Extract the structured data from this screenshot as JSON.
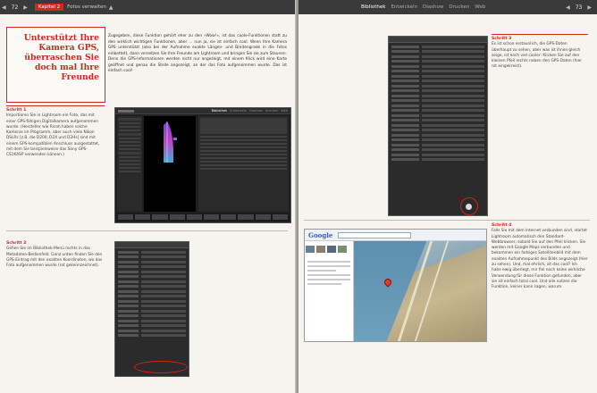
{
  "running_head_left": {
    "page_number": "72",
    "chapter": "Kapitel 2",
    "section": "Fotos verwalten"
  },
  "running_head_right": {
    "page_number": "73",
    "modules": [
      "Bibliothek",
      "Entwickeln",
      "Diashow",
      "Drucken",
      "Web"
    ],
    "active_module": "Bibliothek"
  },
  "headline": "Unterstützt Ihre Kamera GPS, überraschen Sie doch mal Ihre Freunde",
  "intro": "Zugegeben, diese Funktion gehört eher zu den »Wow!«, ist das coole-Funktionen statt zu den wirklich wichtigen Funktionen, aber ... nun ja, sie ist einfach cool. Wenn Ihre Kamera GPS unterstützt (also bei der Aufnahme exakte Längen- und Breitengrade in die Fotos einbettet), dann versetzen Sie Ihre Freunde am Lightroom und bringen Sie sie zum Staunen. Denn die GPS-Informationen werden nicht nur angezeigt, mit einem Klick wird eine Karte geöffnet und genau die Stelle angezeigt, an der das Foto aufgenommen wurde. Das ist einfach cool!",
  "steps": [
    {
      "title": "Schritt 1",
      "text": "Importieren Sie in Lightroom ein Foto, das mit einer GPS-fähigen Digitalkamera aufgenommen wurde. (Hersteller wie Ricoh haben solche Kameras im Programm, aber auch viele Nikon DSLRs [z.B. die D200, D2X und D2Hs] sind mit einem GPS-kompatiblen Anschluss ausgestattet, mit dem Sie beispielsweise das Sony GPS-CS1KASP verwenden können.)"
    },
    {
      "title": "Schritt 2",
      "text": "Gehen Sie im Bibliothek-Menü rechts in das Metadaten-Bedienfeld. Ganz unten finden Sie den GPS-Eintrag mit den exakten Koordinaten, wo das Foto aufgenommen wurde (rot gekennzeichnet)."
    },
    {
      "title": "Schritt 3",
      "text": "Es ist schon erstaunlich, die GPS-Daten überhaupt zu sehen, aber was ist ihnen gleich zeige, ist noch viel cooler: Klicken Sie auf den kleinen Pfeil rechts neben den GPS-Daten (hier rot eingekreist)."
    },
    {
      "title": "Schritt 4",
      "text": "Falls Sie mit dem Internet verbunden sind, startet Lightroom automatisch den Standard-Webbrowser, sobald Sie auf den Pfeil klicken. Sie werden mit Google Maps verbunden und bekommen ein farbiges Satellitenbild mit dem exakten Aufnahmepunkt des Bilds angezeigt (hier zu sehen). Und, mal ehrlich, ist das cool? Ich habe ewig überlegt, mir fiel noch keine wirkliche Verwendung für diese Funktion gefunden, aber sie ist einfach total cool. Und alle nutzen die Funktion, keiner kann sagen, warum."
    }
  ],
  "screenshot_lr_modules": [
    "Bibliothek",
    "Entwickeln",
    "Diashow",
    "Drucken",
    "Web"
  ],
  "google_logo": "Google",
  "colors": {
    "accent": "#cc2a1e",
    "paper": "#f5f4ef",
    "ui_dark": "#2b2b2b"
  }
}
